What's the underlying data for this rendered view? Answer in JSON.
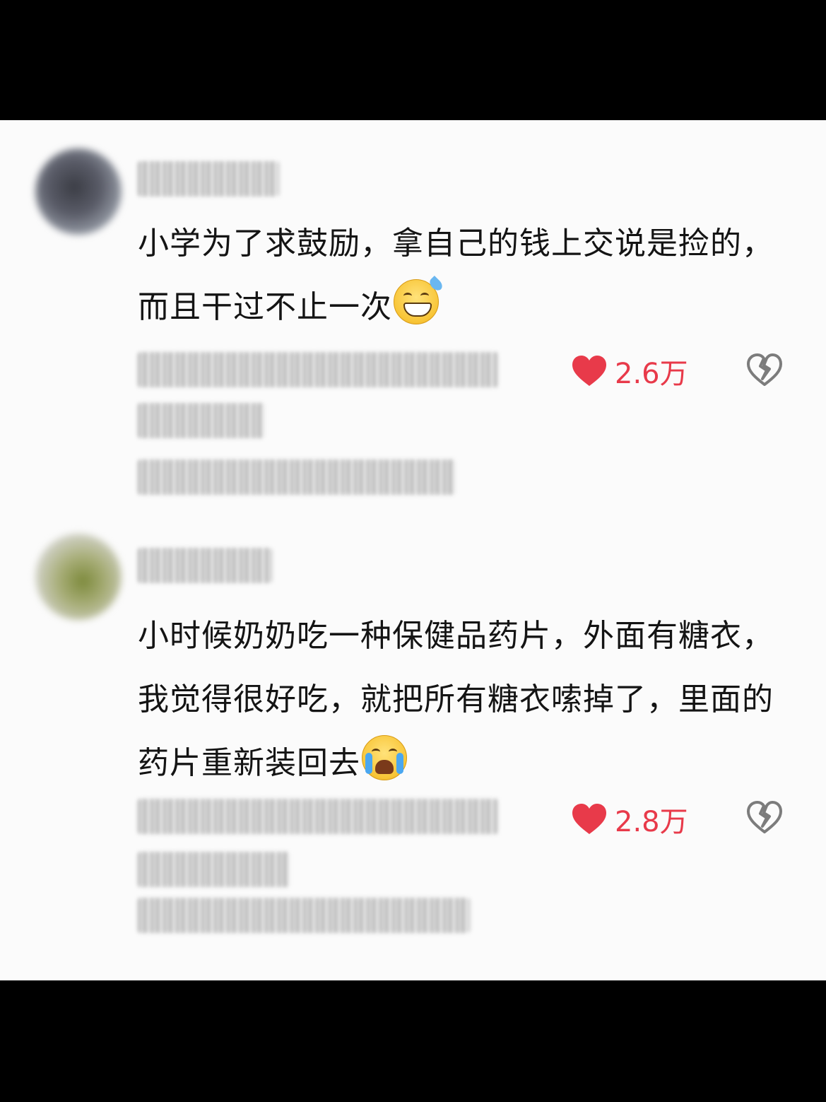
{
  "comments": [
    {
      "text": "小学为了求鼓励，拿自己的钱上交说是捡的，而且干过不止一次",
      "emoji": "grinning-sweat-emoji",
      "likes": "2.6万"
    },
    {
      "text": "小时候奶奶吃一种保健品药片，外面有糖衣，我觉得很好吃，就把所有糖衣嗦掉了，里面的药片重新装回去",
      "emoji": "crying-laughing-emoji",
      "likes": "2.8万"
    }
  ],
  "colors": {
    "like": "#e83a4a",
    "text": "#141414",
    "background": "#fbfbfb",
    "letterbox": "#000000"
  }
}
